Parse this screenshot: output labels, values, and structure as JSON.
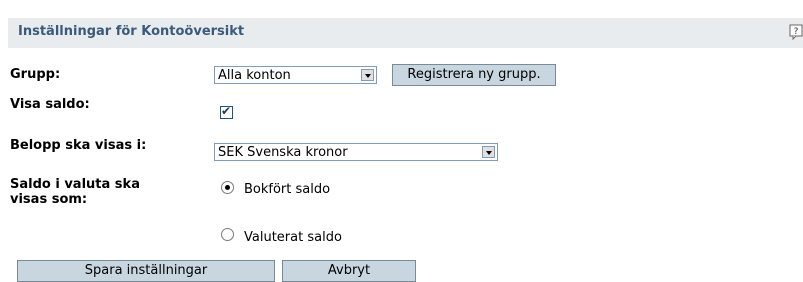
{
  "header": {
    "title": "Inställningar för Kontoöversikt",
    "help_icon": "help-icon"
  },
  "form": {
    "group": {
      "label": "Grupp:",
      "value": "Alla konton",
      "register_button": "Registrera ny grupp."
    },
    "show_balance": {
      "label": "Visa saldo:",
      "checked": true
    },
    "amount_currency": {
      "label": "Belopp ska visas i:",
      "value": "SEK Svenska kronor"
    },
    "currency_balance": {
      "label_line1": "Saldo i valuta ska",
      "label_line2": "visas som:",
      "options": [
        {
          "label": "Bokfört saldo",
          "selected": true
        },
        {
          "label": "Valuterat saldo",
          "selected": false
        }
      ]
    }
  },
  "actions": {
    "save_label": "Spara inställningar",
    "cancel_label": "Avbryt"
  }
}
